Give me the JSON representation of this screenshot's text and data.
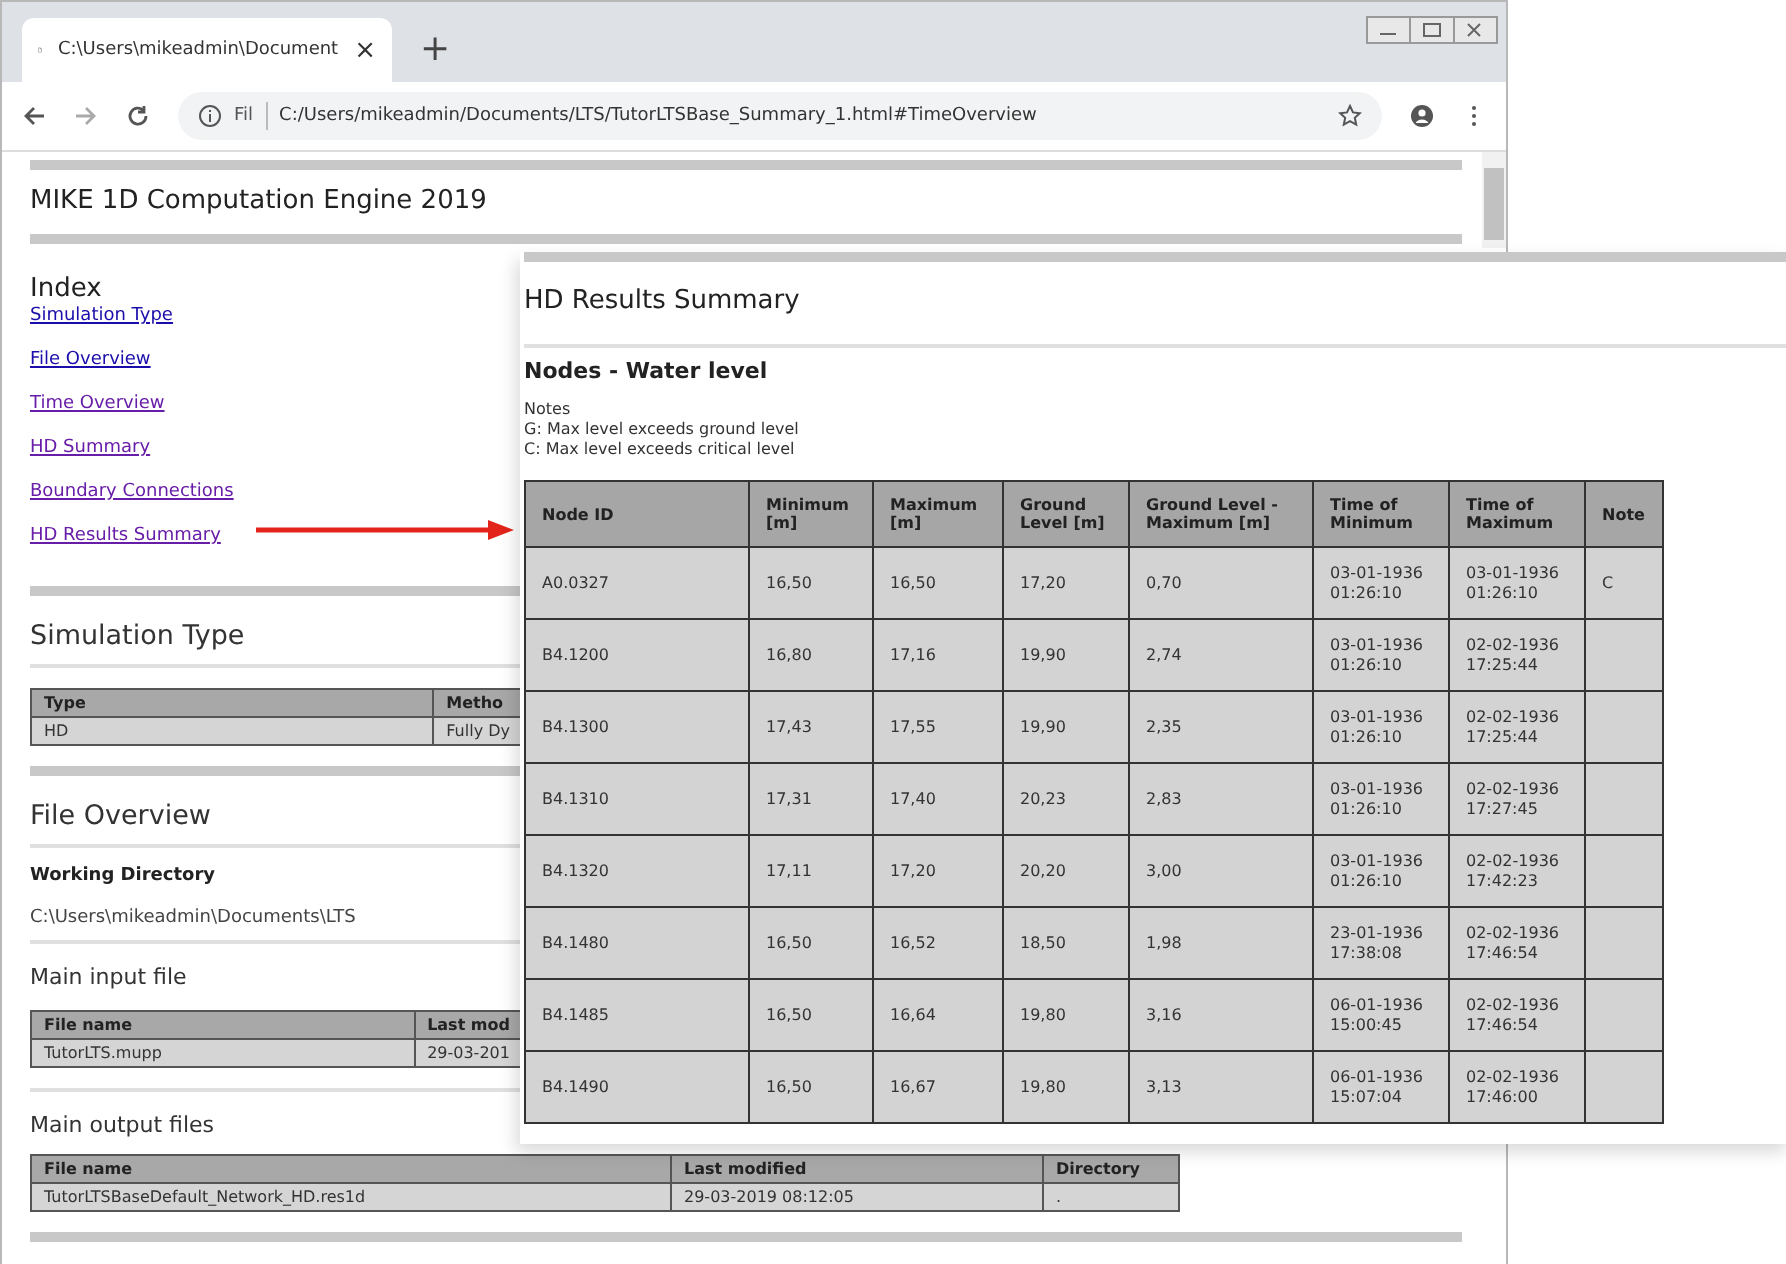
{
  "browser": {
    "tab": {
      "title": "C:\\Users\\mikeadmin\\Document",
      "close": "×"
    },
    "new_tab": "+",
    "address": {
      "scheme": "Fil",
      "url": "C:/Users/mikeadmin/Documents/LTS/TutorLTSBase_Summary_1.html#TimeOverview"
    }
  },
  "page": {
    "title": "MIKE 1D Computation Engine 2019",
    "index": {
      "heading": "Index",
      "links": [
        {
          "label": "Simulation Type",
          "visited": false
        },
        {
          "label": "File Overview",
          "visited": false
        },
        {
          "label": "Time Overview",
          "visited": true
        },
        {
          "label": "HD Summary",
          "visited": true
        },
        {
          "label": "Boundary Connections",
          "visited": true
        },
        {
          "label": "HD Results Summary",
          "visited": true
        }
      ]
    },
    "simulation_type": {
      "heading": "Simulation Type",
      "table": {
        "columns": [
          "Type",
          "Metho"
        ],
        "rows": [
          [
            "HD",
            "Fully Dy"
          ]
        ]
      }
    },
    "file_overview": {
      "heading": "File Overview",
      "working_directory": {
        "label": "Working Directory",
        "value": "C:\\Users\\mikeadmin\\Documents\\LTS"
      },
      "main_input": {
        "heading": "Main input file",
        "table": {
          "columns": [
            "File name",
            "Last mod"
          ],
          "rows": [
            [
              "TutorLTS.mupp",
              "29-03-201"
            ]
          ]
        }
      },
      "main_output": {
        "heading": "Main output files",
        "table": {
          "columns": [
            "File name",
            "Last modified",
            "Directory"
          ],
          "rows": [
            [
              "TutorLTSBaseDefault_Network_HD.res1d",
              "29-03-2019 08:12:05",
              "."
            ]
          ]
        }
      }
    }
  },
  "overlay": {
    "title": "HD Results Summary",
    "subtitle": "Nodes - Water level",
    "notes": [
      "Notes",
      "G: Max level exceeds ground level",
      "C: Max level exceeds critical level"
    ],
    "table": {
      "columns": [
        "Node ID",
        "Minimum [m]",
        "Maximum [m]",
        "Ground Level [m]",
        "Ground Level - Maximum [m]",
        "Time of Minimum",
        "Time of Maximum",
        "Note"
      ],
      "rows": [
        [
          "A0.0327",
          "16,50",
          "16,50",
          "17,20",
          "0,70",
          "03-01-1936 01:26:10",
          "03-01-1936 01:26:10",
          "C"
        ],
        [
          "B4.1200",
          "16,80",
          "17,16",
          "19,90",
          "2,74",
          "03-01-1936 01:26:10",
          "02-02-1936 17:25:44"
        ],
        [
          "B4.1300",
          "17,43",
          "17,55",
          "19,90",
          "2,35",
          "03-01-1936 01:26:10",
          "02-02-1936 17:25:44"
        ],
        [
          "B4.1310",
          "17,31",
          "17,40",
          "20,23",
          "2,83",
          "03-01-1936 01:26:10",
          "02-02-1936 17:27:45"
        ],
        [
          "B4.1320",
          "17,11",
          "17,20",
          "20,20",
          "3,00",
          "03-01-1936 01:26:10",
          "02-02-1936 17:42:23"
        ],
        [
          "B4.1480",
          "16,50",
          "16,52",
          "18,50",
          "1,98",
          "23-01-1936 17:38:08",
          "02-02-1936 17:46:54"
        ],
        [
          "B4.1485",
          "16,50",
          "16,64",
          "19,80",
          "3,16",
          "06-01-1936 15:00:45",
          "02-02-1936 17:46:54"
        ],
        [
          "B4.1490",
          "16,50",
          "16,67",
          "19,80",
          "3,13",
          "06-01-1936 15:07:04",
          "02-02-1936 17:46:00"
        ]
      ]
    }
  }
}
